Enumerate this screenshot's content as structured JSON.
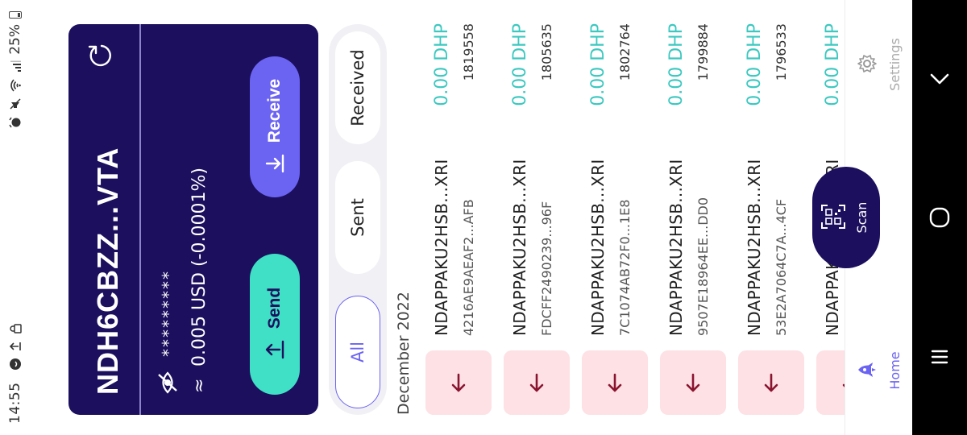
{
  "status_bar": {
    "time": "14:55",
    "battery": "25%",
    "icons": [
      "alarm-icon",
      "mute-icon",
      "wifi-icon",
      "signal-icon",
      "battery-icon",
      "whatsapp-icon",
      "upload-icon",
      "lock-icon"
    ]
  },
  "wallet": {
    "address": "NDH6CBZZ...VTA",
    "masked_balance": "*********",
    "approx_symbol": "≈",
    "fiat_value": "0.005 USD (-0.0001%)",
    "send_label": "Send",
    "receive_label": "Receive"
  },
  "filters": {
    "tabs": [
      {
        "label": "All",
        "selected": true
      },
      {
        "label": "Sent",
        "selected": false
      },
      {
        "label": "Received",
        "selected": false
      }
    ]
  },
  "history": {
    "month": "December 2022",
    "transactions": [
      {
        "address": "NDAPPAKU2HSB...XRI",
        "hash": "4216AE9AEAF2...AFB",
        "amount": "0.00 DHP",
        "block": "1819558"
      },
      {
        "address": "NDAPPAKU2HSB...XRI",
        "hash": "FDCFF2490239...96F",
        "amount": "0.00 DHP",
        "block": "1805635"
      },
      {
        "address": "NDAPPAKU2HSB...XRI",
        "hash": "7C1074AB72F0...1E8",
        "amount": "0.00 DHP",
        "block": "1802764"
      },
      {
        "address": "NDAPPAKU2HSB...XRI",
        "hash": "9507E18964EE...DD0",
        "amount": "0.00 DHP",
        "block": "1799884"
      },
      {
        "address": "NDAPPAKU2HSB...XRI",
        "hash": "53E2A7064C7A...4CF",
        "amount": "0.00 DHP",
        "block": "1796533"
      },
      {
        "address": "NDAPPAKU2HSB...XRI",
        "hash": "",
        "amount": "0.00 DHP",
        "block": ""
      }
    ]
  },
  "bottom_nav": {
    "home_label": "Home",
    "scan_label": "Scan",
    "settings_label": "Settings"
  },
  "colors": {
    "card": "#1b0f5e",
    "send": "#3fe0c5",
    "receive": "#6b63f2",
    "amount": "#3cc8c0",
    "received_tint": "#fde1e4",
    "arrow": "#8a1430"
  }
}
